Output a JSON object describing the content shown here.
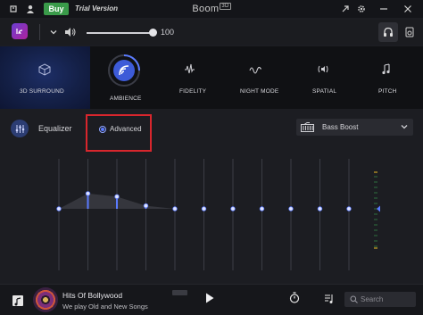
{
  "titlebar": {
    "buy_label": "Buy",
    "trial_label": "Trial Version",
    "app_name": "Boom",
    "app_badge": "3D",
    "window_icons": [
      "back-icon",
      "user-icon",
      "share-icon",
      "settings-gear-icon",
      "minimize-icon",
      "close-icon"
    ]
  },
  "volume": {
    "level": 100,
    "value_label": "100"
  },
  "effects": {
    "items": [
      {
        "label": "3D SURROUND",
        "icon": "cube-icon",
        "active": true
      },
      {
        "label": "AMBIENCE",
        "icon": "ambience-icon",
        "active": true
      },
      {
        "label": "FIDELITY",
        "icon": "fidelity-icon",
        "active": false
      },
      {
        "label": "NIGHT MODE",
        "icon": "night-mode-icon",
        "active": false
      },
      {
        "label": "SPATIAL",
        "icon": "spatial-icon",
        "active": false
      },
      {
        "label": "PITCH",
        "icon": "pitch-icon",
        "active": false
      }
    ]
  },
  "equalizer": {
    "title": "Equalizer",
    "mode_label": "Advanced",
    "preset_label": "Bass Boost",
    "band_levels": [
      0,
      0.15,
      0.12,
      0.03,
      0,
      0,
      0,
      0,
      0,
      0,
      0
    ],
    "gain_level": 0
  },
  "player": {
    "track_title": "Hits Of Bollywood",
    "track_subtitle": "We play Old and New Songs f",
    "search_placeholder": "Search"
  },
  "colors": {
    "accent": "#5b7bff",
    "highlight_box": "#d8262d",
    "buy_button": "#3a9b4a",
    "surround_tile": "#142047"
  }
}
